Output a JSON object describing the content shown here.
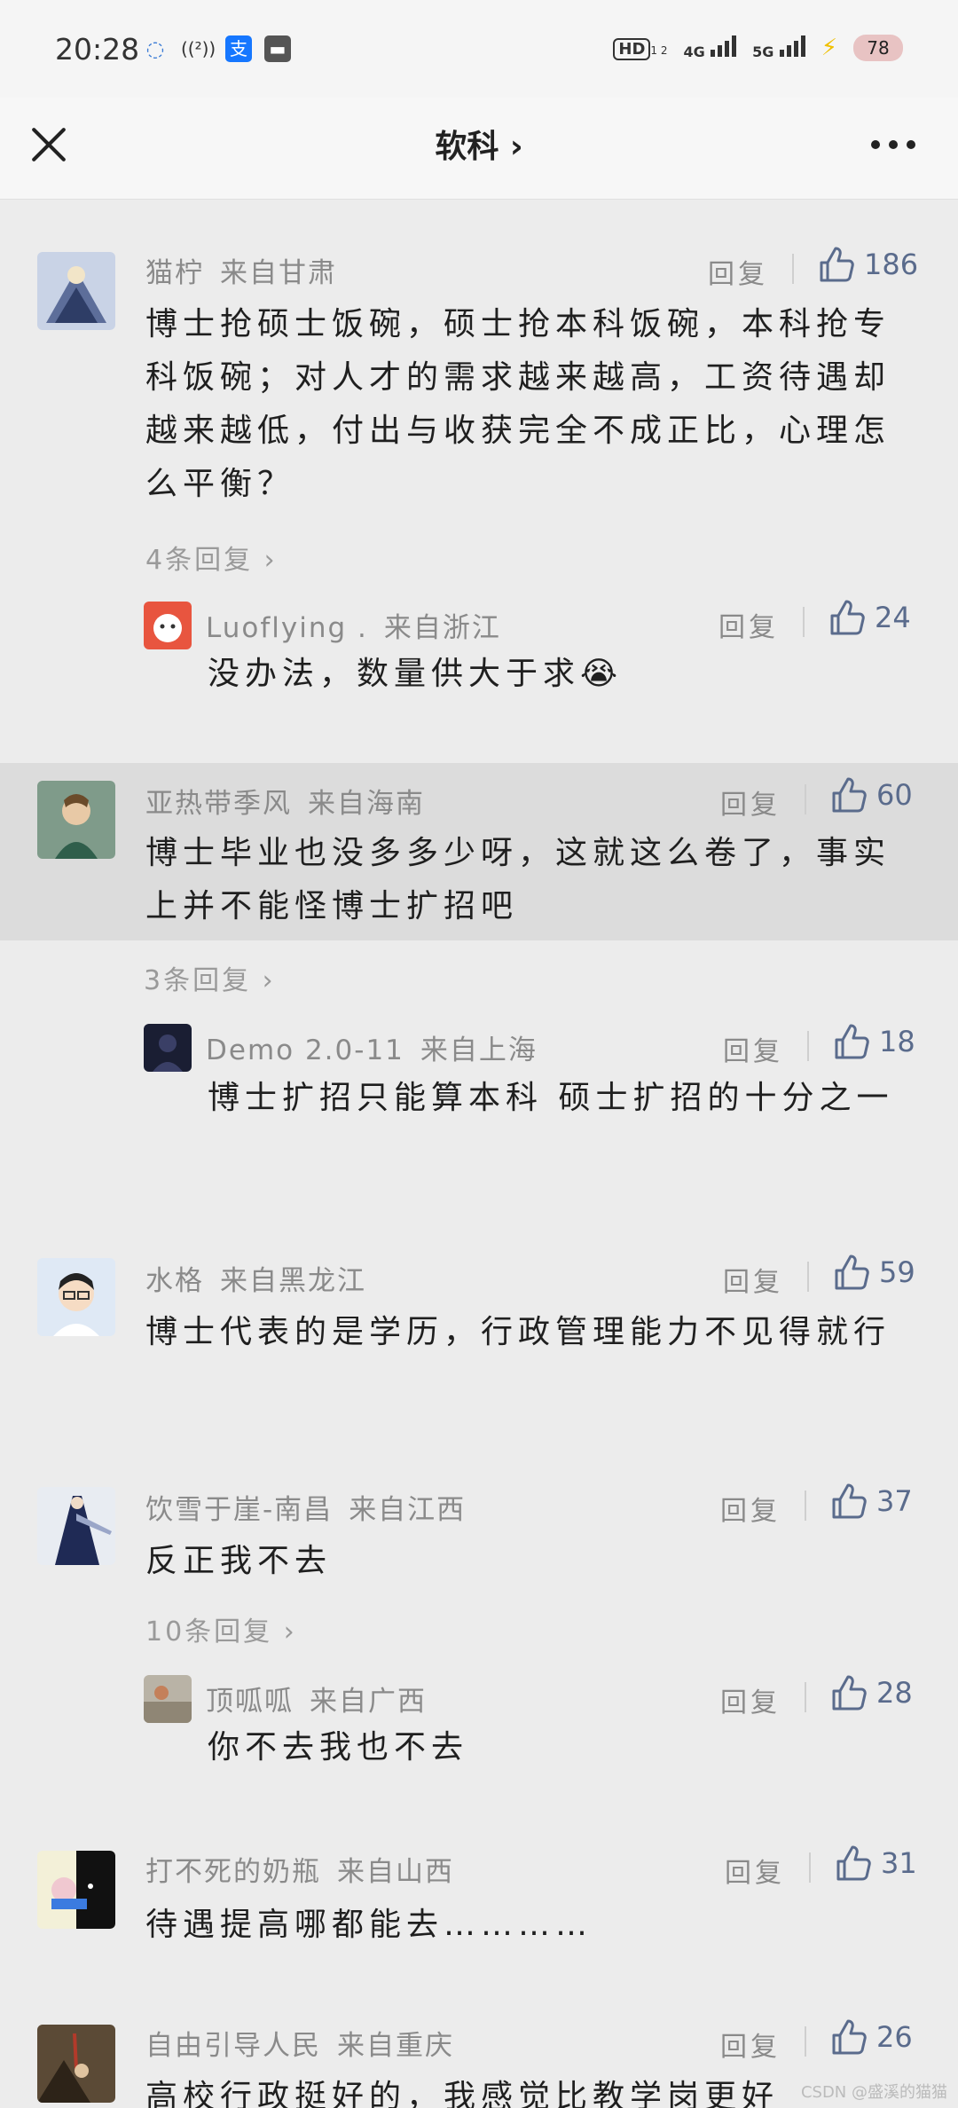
{
  "status": {
    "time": "20:28",
    "left_icons": [
      "message-icon",
      "wifi-call-icon",
      "alipay-icon",
      "app-icon"
    ],
    "alipay_glyph": "支",
    "call_glyph": "((²))",
    "hd_label": "HD",
    "hd_sub": "1 2",
    "net1": "4G",
    "net2": "5G",
    "battery": "78"
  },
  "header": {
    "title": "软科 ›"
  },
  "comments": [
    {
      "user": "猫柠",
      "location": "来自甘肃",
      "reply": "回复",
      "likes": "186",
      "text": "博士抢硕士饭碗，硕士抢本科饭碗，本科抢专科饭碗；对人才的需求越来越高，工资待遇却越来越低，付出与收获完全不成正比，心理怎么平衡？",
      "replies_link": "4条回复 ›",
      "sub": {
        "user": "Luoflying .",
        "location": "来自浙江",
        "reply": "回复",
        "likes": "24",
        "text": "没办法，数量供大于求😭"
      }
    },
    {
      "user": "亚热带季风",
      "location": "来自海南",
      "reply": "回复",
      "likes": "60",
      "text": "博士毕业也没多多少呀，这就这么卷了，事实上并不能怪博士扩招吧",
      "replies_link": "3条回复 ›",
      "sub": {
        "user": "Demo 2.0-11",
        "location": "来自上海",
        "reply": "回复",
        "likes": "18",
        "text": "博士扩招只能算本科 硕士扩招的十分之一"
      }
    },
    {
      "user": "水格",
      "location": "来自黑龙江",
      "reply": "回复",
      "likes": "59",
      "text": "博士代表的是学历，行政管理能力不见得就行"
    },
    {
      "user": "饮雪于崖-南昌",
      "location": "来自江西",
      "reply": "回复",
      "likes": "37",
      "text": "反正我不去",
      "replies_link": "10条回复 ›",
      "sub": {
        "user": "顶呱呱",
        "location": "来自广西",
        "reply": "回复",
        "likes": "28",
        "text": "你不去我也不去"
      }
    },
    {
      "user": "打不死的奶瓶",
      "location": "来自山西",
      "reply": "回复",
      "likes": "31",
      "text": "待遇提高哪都能去…………"
    },
    {
      "user": "自由引导人民",
      "location": "来自重庆",
      "reply": "回复",
      "likes": "26",
      "text": "高校行政挺好的，我感觉比教学岗更好"
    }
  ],
  "watermark": "CSDN @盛溪的猫猫",
  "colors": {
    "like_blue": "#5a6b8c",
    "page_bg": "#ececec",
    "highlight_bg": "#dcdcdc"
  }
}
